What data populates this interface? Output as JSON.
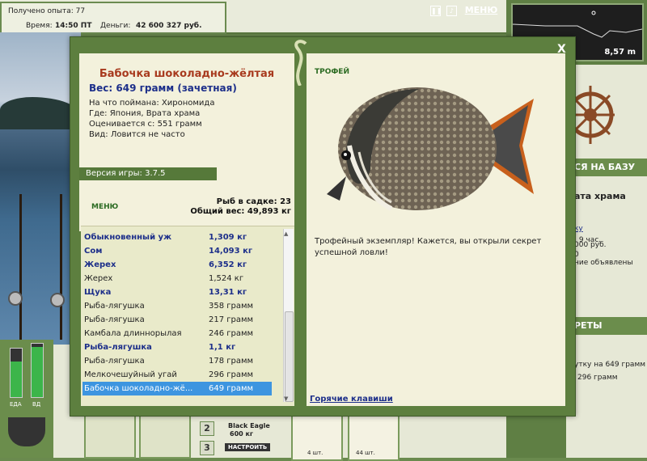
{
  "hud": {
    "xp_label": "Получено опыта: 77",
    "time_label": "Время:",
    "time_value": "14:50 ПТ",
    "money_label": "Деньги:",
    "money_value": "42 600 327 руб.",
    "menu_label": "МЕНЮ",
    "depth_value": "8,57 m",
    "gauge_left_label": "ЕДА",
    "gauge_right_label": "ВД"
  },
  "side_panel": {
    "base_label": "СЯ НА БАЗУ",
    "location": "ата храма",
    "line1": "ку",
    "line2": ": 9 час.",
    "line3": "000 руб.",
    "line4": "0",
    "line5": "ние объявлены",
    "records_label": "РЕТЫ",
    "rec1": "утку на 649 грамм",
    "rec2": "296 грамм"
  },
  "shop": {
    "item_name": "Black Eagle",
    "item_weight": "600 кг",
    "setup_button": "НАСТРОИТЬ",
    "qty1": "4 шт.",
    "qty2": "44 шт.",
    "num2": "2",
    "num3": "3"
  },
  "dialog": {
    "close_label": "X",
    "fish_name": "Бабочка шоколадно-жёлтая",
    "weight_line": "Вес: 649 грамм (зачетная)",
    "caught_on": "На что поймана: Хирономида",
    "where": "Где: Япония, Врата храма",
    "valued_from": "Оценивается с: 551 грамм",
    "kind": "Вид: Ловится не часто",
    "version": "Версия игры: 3.7.5",
    "menu_label": "МЕНЮ",
    "keepnet_count": "Рыб в садке: 23",
    "total_weight": "Общий вес: 49,893 кг",
    "trophy_tag": "ТРОФЕЙ",
    "trophy_text": "Трофейный экземпляр! Кажется, вы открыли секрет успешной ловли!",
    "hotkeys": "Горячие клавиши"
  },
  "catch_list": [
    {
      "name": "Обыкновенный уж",
      "weight": "1,309 кг",
      "bold": true
    },
    {
      "name": "Сом",
      "weight": "14,093 кг",
      "bold": true
    },
    {
      "name": "Жерех",
      "weight": "6,352 кг",
      "bold": true
    },
    {
      "name": "Жерех",
      "weight": "1,524 кг",
      "bold": false
    },
    {
      "name": "Щука",
      "weight": "13,31 кг",
      "bold": true
    },
    {
      "name": "Рыба-лягушка",
      "weight": "358 грамм",
      "bold": false
    },
    {
      "name": "Рыба-лягушка",
      "weight": "217 грамм",
      "bold": false
    },
    {
      "name": "Камбала длиннорылая",
      "weight": "246 грамм",
      "bold": false
    },
    {
      "name": "Рыба-лягушка",
      "weight": "1,1 кг",
      "bold": true
    },
    {
      "name": "Рыба-лягушка",
      "weight": "178 грамм",
      "bold": false
    },
    {
      "name": "Мелкочешуйный угай",
      "weight": "296 грамм",
      "bold": false
    },
    {
      "name": "Бабочка шоколадно-жё...",
      "weight": "649 грамм",
      "bold": false,
      "selected": true
    }
  ],
  "colors": {
    "panel_green": "#5d7f3f",
    "paper": "#f3f1dc",
    "title_red": "#a83a1e",
    "bold_blue": "#1d2f8a",
    "selected_blue": "#3d95e0"
  }
}
